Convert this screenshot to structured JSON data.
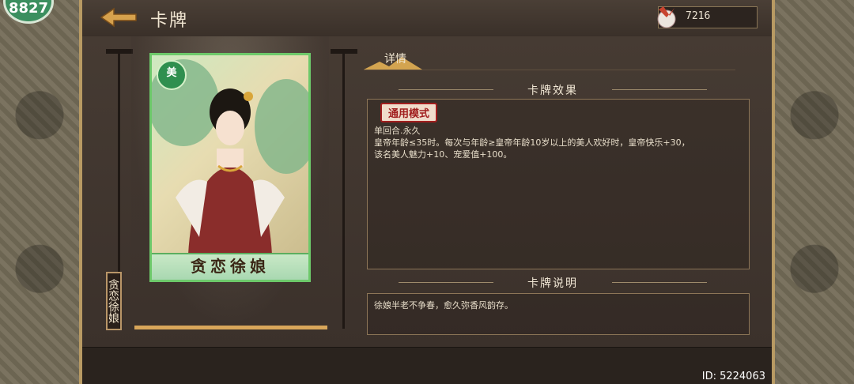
{
  "badge": {
    "value": "8827"
  },
  "header": {
    "title": "卡牌"
  },
  "currency": {
    "value": "7216",
    "icon": "feather-coin-icon"
  },
  "card": {
    "name": "贪恋徐娘",
    "side_label": "贪恋徐娘",
    "badge_glyph": "美",
    "progress": 1.0
  },
  "tabs": {
    "details": "详情"
  },
  "effect": {
    "header": "卡牌效果",
    "mode": "通用模式",
    "text": "单回合.永久\n皇帝年龄≤35时。每次与年龄≥皇帝年龄10岁以上的美人欢好时，皇帝快乐+30，\n该名美人魅力+10、宠爱值+100。"
  },
  "description": {
    "header": "卡牌说明",
    "text": "徐娘半老不争春，愈久弥香风韵存。"
  },
  "footer": {
    "id": "ID: 5224063"
  },
  "colors": {
    "accent": "#d8a65a",
    "card_border": "#6dc96a",
    "mode_red": "#a11e1e"
  }
}
